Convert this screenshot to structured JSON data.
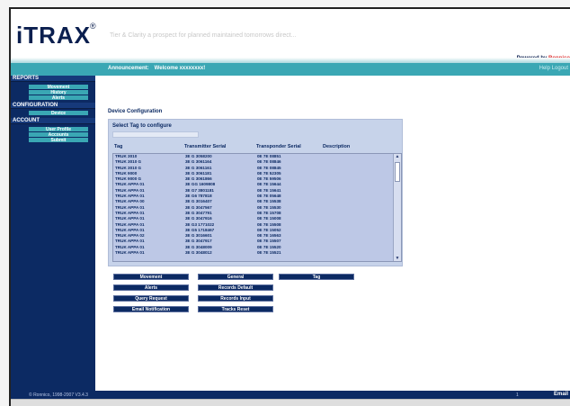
{
  "header": {
    "logo_text": "iTRAX",
    "logo_mark": "®",
    "tagline": "Tier & Clarity a prospect for planned maintained tomorrows direct...",
    "powered_by": "Powered by",
    "powered_by_brand": "Ronnico"
  },
  "topbar": {
    "announcement": "Announcement:",
    "welcome": "Welcome xxxxxxxx!",
    "right_text": "Help  Logout"
  },
  "sidebar": {
    "groups": [
      {
        "label": "REPORTS",
        "items": [
          "Movement",
          "History",
          "Alerts"
        ]
      },
      {
        "label": "CONFIGURATION",
        "items": [
          "Device"
        ]
      },
      {
        "label": "ACCOUNT",
        "items": [
          "User Profile",
          "Accounts",
          "Submit"
        ]
      }
    ]
  },
  "main": {
    "section_title": "Device Configuration",
    "panel_label": "Select Tag to configure",
    "search_value": "",
    "columns": [
      "Tag",
      "Transmitter Serial",
      "Transponder Serial",
      "Description"
    ],
    "rows": [
      [
        "TRUK 3010",
        "3E G 3058200",
        "0E 7E 08851",
        ""
      ],
      [
        "TRUK 3010 G",
        "3E G 3061164",
        "0E 7E 08846",
        ""
      ],
      [
        "TRUK 3010 G",
        "3E G 3061161",
        "0E 7E 08845",
        ""
      ],
      [
        "TRUK 9000",
        "3E G 3061181",
        "0E 7E 52305",
        ""
      ],
      [
        "TRUK 9000 G",
        "3E G 3061866",
        "0E 7E 59506",
        ""
      ],
      [
        "TRUK APPA 01",
        "3E GG 1609808",
        "0E 7E 15644",
        ""
      ],
      [
        "TRUK APPA 01",
        "3E G7 3801181",
        "0E 7E 15641",
        ""
      ],
      [
        "TRUK APPA 01",
        "3E G6 787818",
        "0E 7E 05648",
        ""
      ],
      [
        "TRUK APPA 00",
        "3E G 3016407",
        "0E 7E 15538",
        ""
      ],
      [
        "TRUK APPA 01",
        "3E G 3047567",
        "0E 7E 15530",
        ""
      ],
      [
        "TRUK APPA 01",
        "3E G 3047791",
        "0E 7E 15708",
        ""
      ],
      [
        "TRUK APPA 01",
        "3E G 3047916",
        "0E 7E 15008",
        ""
      ],
      [
        "TRUK APPA 01",
        "3E G3 1771022",
        "0E 7E 15508",
        ""
      ],
      [
        "TRUK APPA 01",
        "3E G5 1718467",
        "0E 7E 15052",
        ""
      ],
      [
        "TRUK APPA 02",
        "3E G 3016601",
        "0E 7E 16563",
        ""
      ],
      [
        "TRUK APPA 01",
        "3E G 3047917",
        "0E 7E 15507",
        ""
      ],
      [
        "TRUK APPA 01",
        "3E G 3048009",
        "0E 7E 15520",
        ""
      ],
      [
        "TRUK APPA 01",
        "3E G 3048012",
        "0E 7E 15521",
        ""
      ]
    ],
    "buttons": {
      "b1": "Movement",
      "b2": "General",
      "b3": "Tag",
      "b4": "Alerts",
      "b5": "Records Default",
      "b6": "Query Request",
      "b7": "Records Input",
      "b8": "Email Notification",
      "b9": "Tracks Reset"
    }
  },
  "footer": {
    "copyright": "© Ronnico, 1998-2007 V3.4.3",
    "mid": "1",
    "right": "Email"
  }
}
